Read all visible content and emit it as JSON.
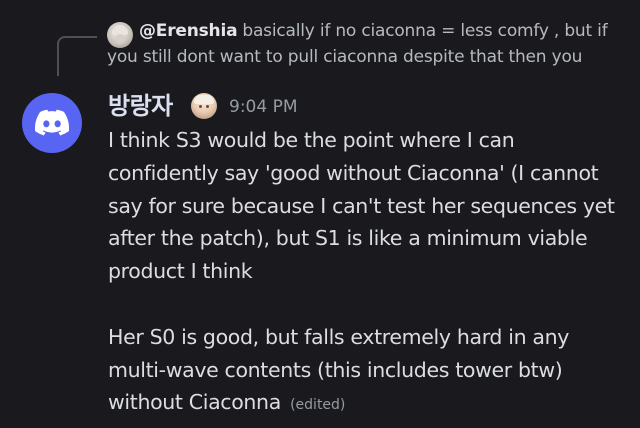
{
  "reply": {
    "author": "@Erenshia",
    "text_line1": "basically if no ciaconna = less comfy , but if",
    "text_line2": "you still dont want to pull ciaconna despite that then you",
    "avatar_icon": "character-avatar"
  },
  "message": {
    "avatar_icon": "discord-logo-icon",
    "avatar_color": "#5865f2",
    "username": "방랑자",
    "badge_icon": "character-badge-icon",
    "timestamp": "9:04 PM",
    "paragraph1": "I think S3 would be the point where I can confidently say 'good without Ciaconna' (I cannot say for sure because I can't test her sequences yet after the patch), but S1 is like a minimum viable product I think",
    "paragraph2": "Her S0 is good, but falls extremely hard in any multi-wave contents (this includes tower btw) without Ciaconna",
    "edited_label": "(edited)"
  },
  "colors": {
    "background": "#1a1a1e",
    "text": "#dbdee1",
    "muted": "#949ba4"
  }
}
